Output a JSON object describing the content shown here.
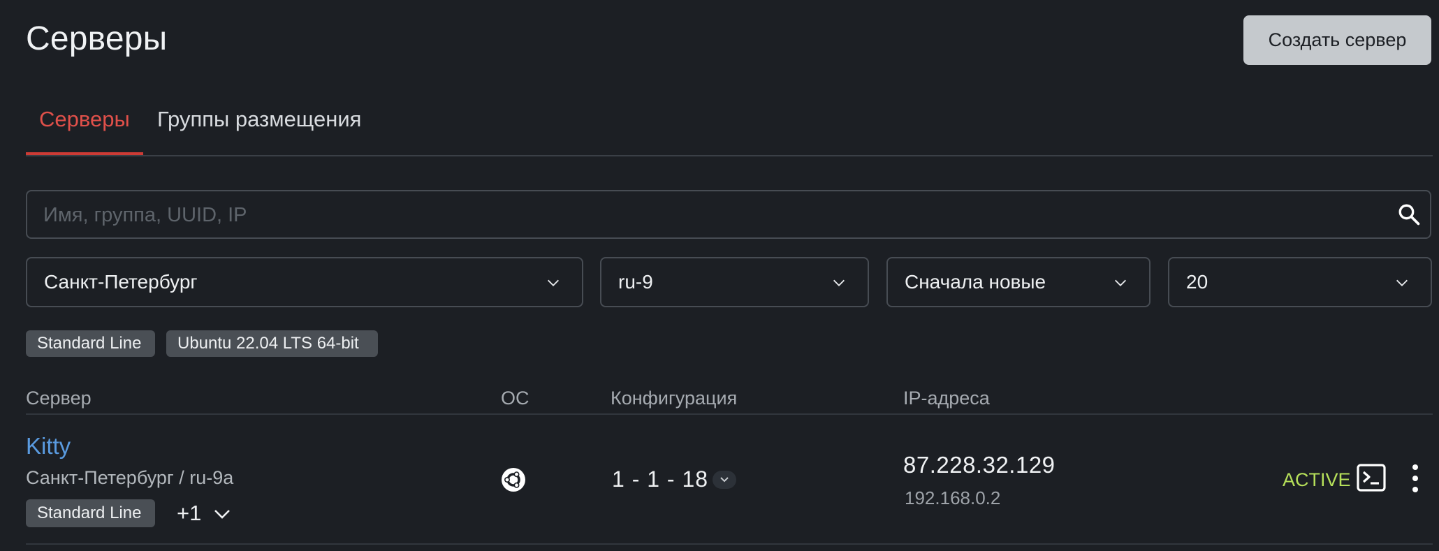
{
  "header": {
    "title": "Серверы",
    "create_button": "Создать сервер"
  },
  "tabs": [
    {
      "label": "Серверы",
      "active": true
    },
    {
      "label": "Группы размещения",
      "active": false
    }
  ],
  "search": {
    "placeholder": "Имя, группа, UUID, IP",
    "icon": "search-icon"
  },
  "filters": {
    "region": "Санкт-Петербург",
    "zone": "ru-9",
    "sort": "Сначала новые",
    "page_size": "20"
  },
  "active_chips": [
    "Standard Line",
    "Ubuntu 22.04 LTS 64-bit"
  ],
  "table": {
    "columns": [
      "Сервер",
      "ОС",
      "Конфигурация",
      "IP-адреса"
    ],
    "rows": [
      {
        "name": "Kitty",
        "location": "Санкт-Петербург / ru-9a",
        "tag": "Standard Line",
        "extra_tags": "+1",
        "os_icon": "ubuntu-icon",
        "config": "1 - 1 - 18",
        "ip_public": "87.228.32.129",
        "ip_private": "192.168.0.2",
        "status": "ACTIVE"
      }
    ]
  },
  "colors": {
    "background": "#1c1f24",
    "accent_tab": "#e0504a",
    "link": "#5a9be0",
    "status_active": "#b6e05a",
    "button_bg": "#c5c9cd"
  }
}
